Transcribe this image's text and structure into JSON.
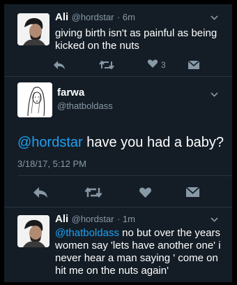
{
  "tweet1": {
    "name": "Ali",
    "handle": "@hordstar",
    "time": "· 6m",
    "text": "giving birth isn't as painful as being kicked on the nuts",
    "like_count": "3"
  },
  "tweet2": {
    "name": "farwa",
    "handle": "@thatboldass",
    "mention": "@hordstar",
    "text": " have you had a baby?",
    "timestamp": "3/18/17, 5:12 PM"
  },
  "tweet3": {
    "name": "Ali",
    "handle": "@hordstar",
    "time": "· 1m",
    "mention": "@thatboldass",
    "text": " no but over the years women say 'lets have another one' i never hear a man saying ' come on hit me on the nuts again'"
  },
  "colors": {
    "background": "#141d26",
    "accent": "#1da1f2",
    "muted": "#8899a6"
  },
  "icons": [
    "reply-icon",
    "retweet-icon",
    "like-icon",
    "dm-icon",
    "chevron-down-icon"
  ]
}
